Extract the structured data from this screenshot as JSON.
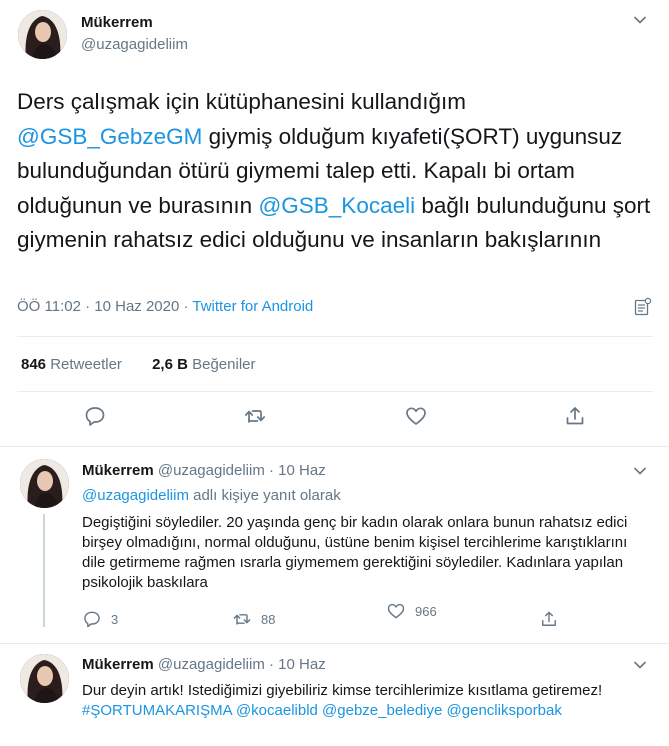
{
  "main": {
    "name": "Mükerrem",
    "handle": "@uzagagideliim",
    "text_parts": {
      "p1": "Ders çalışmak için kütüphanesini kullandığım ",
      "m1": "@GSB_GebzeGM",
      "p2": " giymiş olduğum kıyafeti(ŞORT) uygunsuz bulunduğundan ötürü giymemi talep etti. Kapalı bi ortam olduğunun ve burasının ",
      "m2": "@GSB_Kocaeli",
      "p3": " bağlı bulunduğunu şort giymenin rahatsız edici olduğunu ve insanların bakışlarının"
    },
    "time": "ÖÖ 11:02 · 10 Haz 2020 · ",
    "source": "Twitter for Android",
    "retweets_count": "846",
    "retweets_label": "Retweetler",
    "likes_count": "2,6 B",
    "likes_label": "Beğeniler"
  },
  "replies": [
    {
      "name": "Mükerrem",
      "handle": "@uzagagideliim",
      "dot": " · ",
      "date": "10 Haz",
      "reply_to_handle": "@uzagagideliim",
      "reply_to_label": " adlı kişiye yanıt olarak",
      "text": "Degiştiğini söylediler. 20 yaşında genç bir kadın olarak onlara bunun rahatsız edici birşey olmadığını, normal olduğunu, üstüne benim kişisel tercihlerime karıştıklarını dile getirmeme rağmen ısrarla giymemem gerektiğini söylediler. Kadınlara yapılan psikolojik baskılara",
      "reply_count": "3",
      "retweet_count": "88",
      "like_count": "966"
    },
    {
      "name": "Mükerrem",
      "handle": "@uzagagideliim",
      "dot": " · ",
      "date": "10 Haz",
      "text_plain": "Dur deyin artık! Istediğimizi giyebiliriz kimse tercihlerimize kısıtlama getiremez! ",
      "hashtag": "#ŞORTUMAKARIŞMA",
      "mention1": "@kocaelibld",
      "mention2": "@gebze_belediye",
      "mention3": "@genclikspor­bak"
    }
  ],
  "colors": {
    "link": "#1b95e0",
    "muted": "#657786",
    "text": "#14171a",
    "divider": "#e6ecf0"
  }
}
